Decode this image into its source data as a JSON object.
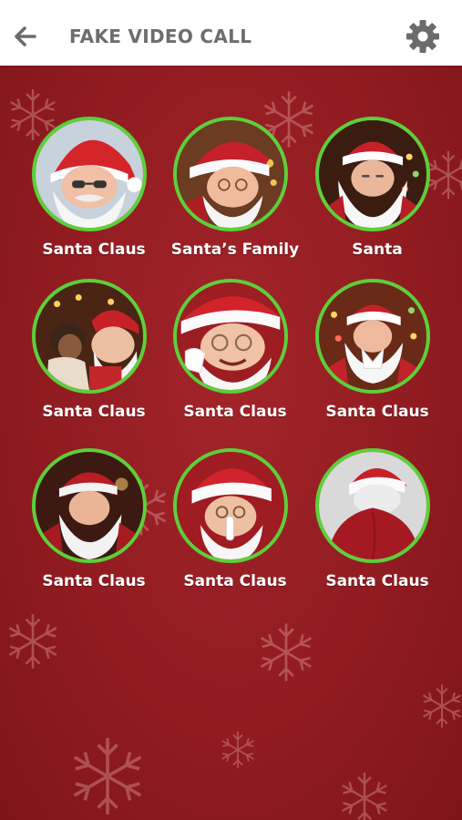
{
  "header": {
    "title": "FAKE VIDEO CALL",
    "back_icon": "arrow-left-icon",
    "settings_icon": "gear-icon"
  },
  "colors": {
    "background": "#8f1a1f",
    "avatar_ring": "#5bd03a",
    "header_bg": "#ffffff",
    "title_text": "#6d6d6d"
  },
  "contacts": [
    {
      "name": "Santa Claus"
    },
    {
      "name": "Santa’s Family"
    },
    {
      "name": "Santa"
    },
    {
      "name": "Santa Claus"
    },
    {
      "name": "Santa Claus"
    },
    {
      "name": "Santa Claus"
    },
    {
      "name": "Santa Claus"
    },
    {
      "name": "Santa Claus"
    },
    {
      "name": "Santa Claus"
    }
  ]
}
